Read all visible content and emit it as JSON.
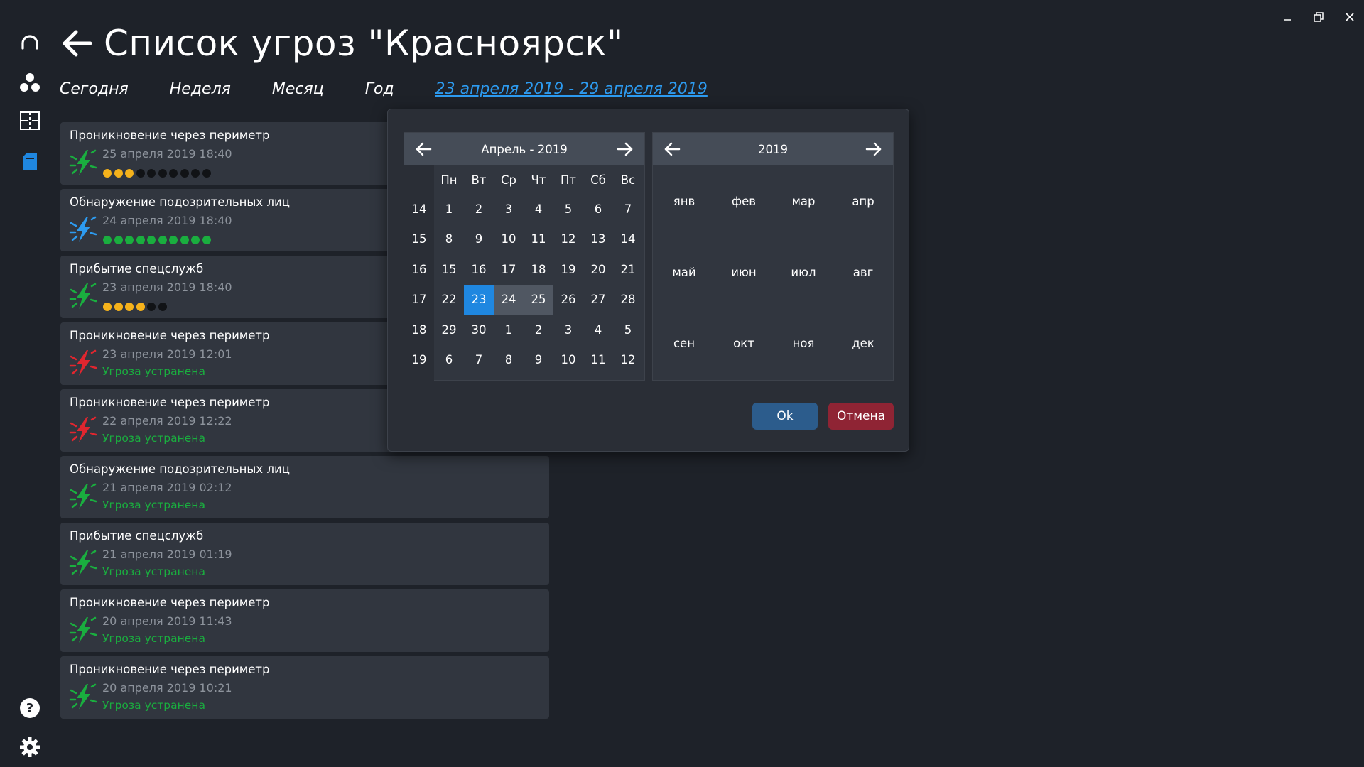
{
  "window": {
    "minimize_icon": "minimize-icon",
    "restore_icon": "restore-icon",
    "close_icon": "close-icon"
  },
  "rail": {
    "items": [
      {
        "icon": "headset-icon"
      },
      {
        "icon": "users-icon"
      },
      {
        "icon": "layout-icon"
      },
      {
        "icon": "folder-icon",
        "active": true
      },
      {
        "icon": "help-icon"
      },
      {
        "icon": "gear-icon"
      }
    ]
  },
  "header": {
    "title": "Список угроз \"Красноярск\""
  },
  "tabs": {
    "today": "Сегодня",
    "week": "Неделя",
    "month": "Месяц",
    "year": "Год",
    "range": "23 апреля 2019 - 29 апреля 2019"
  },
  "threats": [
    {
      "title": "Проникновение через периметр",
      "date": "25 апреля 2019 18:40",
      "icon_color": "#1aae3f",
      "dots": [
        "#f5b21b",
        "#f5b21b",
        "#f5b21b",
        "#111316",
        "#111316",
        "#111316",
        "#111316",
        "#111316",
        "#111316",
        "#111316"
      ]
    },
    {
      "title": "Обнаружение подозрительных лиц",
      "date": "24 апреля 2019 18:40",
      "icon_color": "#2d9bf0",
      "dots": [
        "#1aae3f",
        "#1aae3f",
        "#1aae3f",
        "#1aae3f",
        "#1aae3f",
        "#1aae3f",
        "#1aae3f",
        "#1aae3f",
        "#1aae3f",
        "#1aae3f"
      ]
    },
    {
      "title": "Прибытие спецслужб",
      "date": "23 апреля 2019 18:40",
      "icon_color": "#1aae3f",
      "dots": [
        "#f5b21b",
        "#f5b21b",
        "#f5b21b",
        "#f5b21b",
        "#111316",
        "#111316"
      ]
    },
    {
      "title": "Проникновение через периметр",
      "date": "23 апреля 2019 12:01",
      "icon_color": "#e0262f",
      "status": "Угроза устранена"
    },
    {
      "title": "Проникновение через периметр",
      "date": "22 апреля 2019 12:22",
      "icon_color": "#e0262f",
      "status": "Угроза устранена"
    },
    {
      "title": "Обнаружение подозрительных лиц",
      "date": "21 апреля 2019 02:12",
      "icon_color": "#1aae3f",
      "status": "Угроза устранена"
    },
    {
      "title": "Прибытие спецслужб",
      "date": "21 апреля 2019 01:19",
      "icon_color": "#1aae3f",
      "status": "Угроза устранена"
    },
    {
      "title": "Проникновение через периметр",
      "date": "20 апреля 2019 11:43",
      "icon_color": "#1aae3f",
      "status": "Угроза устранена"
    },
    {
      "title": "Проникновение через периметр",
      "date": "20 апреля 2019 10:21",
      "icon_color": "#1aae3f",
      "status": "Угроза устранена"
    }
  ],
  "datepicker": {
    "day_calendar": {
      "title": "Апрель - 2019",
      "weekdays": [
        "Пн",
        "Вт",
        "Ср",
        "Чт",
        "Пт",
        "Сб",
        "Вс"
      ],
      "weeks": [
        {
          "num": "14",
          "days": [
            "1",
            "2",
            "3",
            "4",
            "5",
            "6",
            "7"
          ]
        },
        {
          "num": "15",
          "days": [
            "8",
            "9",
            "10",
            "11",
            "12",
            "13",
            "14"
          ]
        },
        {
          "num": "16",
          "days": [
            "15",
            "16",
            "17",
            "18",
            "19",
            "20",
            "21"
          ]
        },
        {
          "num": "17",
          "days": [
            "22",
            "23",
            "24",
            "25",
            "26",
            "27",
            "28"
          ]
        },
        {
          "num": "18",
          "days": [
            "29",
            "30",
            "1",
            "2",
            "3",
            "4",
            "5"
          ]
        },
        {
          "num": "19",
          "days": [
            "6",
            "7",
            "8",
            "9",
            "10",
            "11",
            "12"
          ]
        }
      ],
      "selected_day": "23",
      "range_days": [
        "24",
        "25"
      ]
    },
    "month_calendar": {
      "title": "2019",
      "months": [
        "янв",
        "фев",
        "мар",
        "апр",
        "май",
        "июн",
        "июл",
        "авг",
        "сен",
        "окт",
        "ноя",
        "дек"
      ]
    },
    "ok_label": "Ok",
    "cancel_label": "Отмена"
  }
}
